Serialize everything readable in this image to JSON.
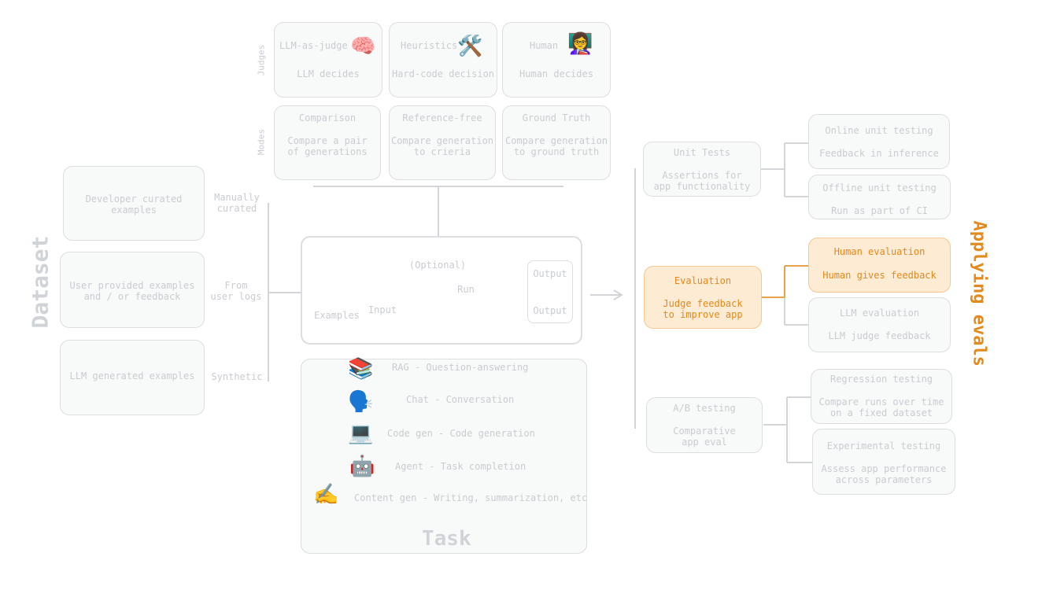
{
  "judges": {
    "section_label": "Judges",
    "items": [
      {
        "title": "LLM-as-judge",
        "desc": "LLM decides",
        "icon": "brain-icon",
        "glyph": "🧠"
      },
      {
        "title": "Heuristics",
        "desc": "Hard-code decision",
        "icon": "hammer-wrench-icon",
        "glyph": "🛠️"
      },
      {
        "title": "Human",
        "desc": "Human decides",
        "icon": "teacher-icon",
        "glyph": "👩‍🏫"
      }
    ]
  },
  "modes": {
    "section_label": "Modes",
    "items": [
      {
        "title": "Comparison",
        "desc": "Compare a pair\nof generations"
      },
      {
        "title": "Reference-free",
        "desc": "Compare generation\nto crieria"
      },
      {
        "title": "Ground Truth",
        "desc": "Compare generation\nto ground truth"
      }
    ]
  },
  "dataset": {
    "title": "Dataset",
    "items": [
      {
        "text": "Developer curated\nexamples",
        "label": "Manually\ncurated"
      },
      {
        "text": "User provided examples\nand / or feedback",
        "label": "From\nuser logs"
      },
      {
        "text": "LLM generated examples",
        "label": "Synthetic"
      }
    ]
  },
  "flow": {
    "optional_label": "(Optional)",
    "run_label": "Run",
    "examples_label": "Examples",
    "input_label": "Input",
    "output_top": "Output",
    "output_bottom": "Output"
  },
  "task": {
    "title": "Task",
    "items": [
      {
        "icon": "books-icon",
        "glyph": "📚",
        "text": "RAG - Question-answering"
      },
      {
        "icon": "speaking-head-icon",
        "glyph": "🗣️",
        "text": "Chat - Conversation"
      },
      {
        "icon": "laptop-icon",
        "glyph": "💻",
        "text": "Code gen - Code generation"
      },
      {
        "icon": "robot-icon",
        "glyph": "🤖",
        "text": "Agent - Task completion"
      },
      {
        "icon": "writing-hand-icon",
        "glyph": "✍️",
        "text": "Content gen - Writing, summarization, etc"
      }
    ]
  },
  "applying": {
    "title": "Applying evals",
    "groups": [
      {
        "title": "Unit Tests",
        "desc": "Assertions for\napp functionality",
        "children": [
          {
            "title": "Online unit testing",
            "desc": "Feedback in inference"
          },
          {
            "title": "Offline unit testing",
            "desc": "Run as part of CI"
          }
        ]
      },
      {
        "title": "Evaluation",
        "desc": "Judge feedback\nto improve app",
        "children": [
          {
            "title": "Human evaluation",
            "desc": "Human gives feedback"
          },
          {
            "title": "LLM evaluation",
            "desc": "LLM judge feedback"
          }
        ]
      },
      {
        "title": "A/B testing",
        "desc": "Comparative\napp eval",
        "children": [
          {
            "title": "Regression testing",
            "desc": "Compare runs over time\non a fixed dataset"
          },
          {
            "title": "Experimental testing",
            "desc": "Assess app performance\nacross parameters"
          }
        ]
      }
    ]
  },
  "colors": {
    "accent": "#e28a1e",
    "muted": "#c9ccd1",
    "border": "#dcdee2"
  }
}
